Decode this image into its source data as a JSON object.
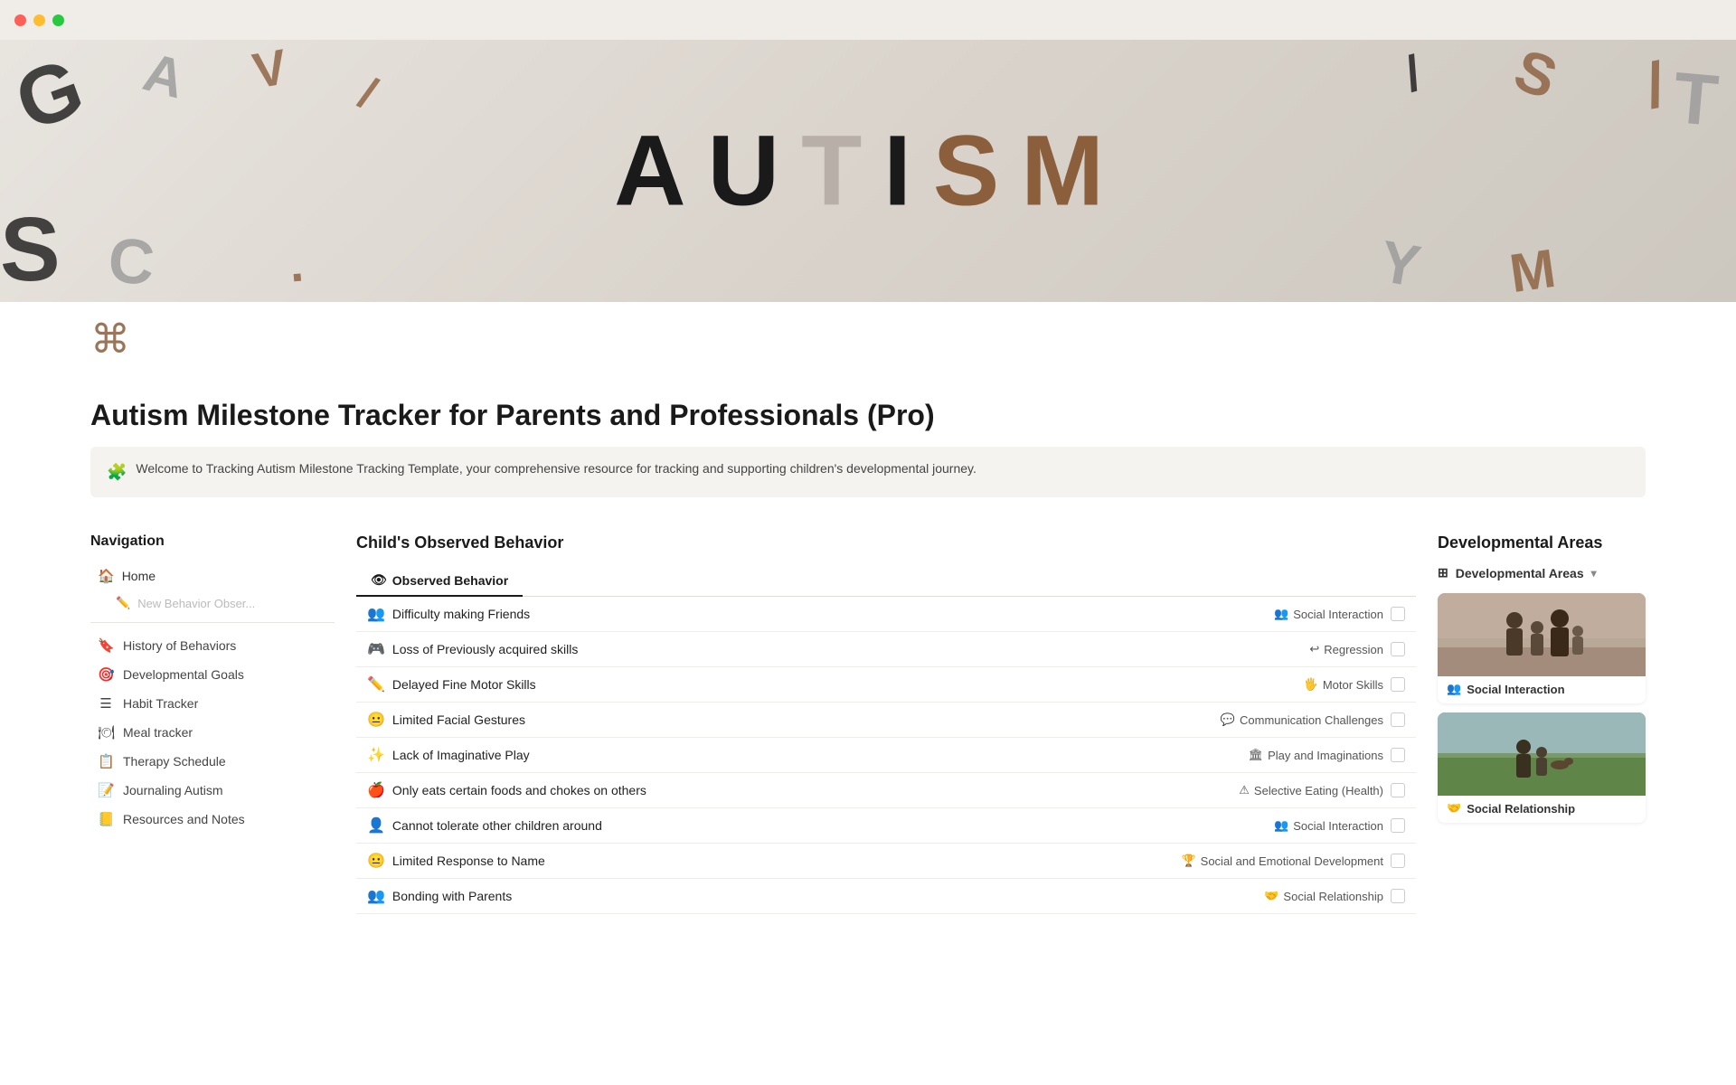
{
  "titlebar": {
    "dots": [
      "red",
      "yellow",
      "green"
    ]
  },
  "hero": {
    "word_letters": [
      {
        "char": "A",
        "style": "black"
      },
      {
        "char": "U",
        "style": "black"
      },
      {
        "char": "T",
        "style": "gray"
      },
      {
        "char": "I",
        "style": "black"
      },
      {
        "char": "S",
        "style": "brown"
      },
      {
        "char": "M",
        "style": "brown"
      }
    ]
  },
  "page": {
    "main_title": "Autism Milestone Tracker for Parents and Professionals (Pro)",
    "welcome_text": "Welcome to Tracking Autism Milestone Tracking Template, your comprehensive resource for tracking and supporting children's developmental journey."
  },
  "sidebar": {
    "title": "Navigation",
    "home_label": "Home",
    "new_behavior_placeholder": "New Behavior Obser...",
    "items": [
      {
        "icon": "🔖",
        "label": "History of Behaviors"
      },
      {
        "icon": "🎯",
        "label": "Developmental Goals"
      },
      {
        "icon": "☰",
        "label": "Habit Tracker"
      },
      {
        "icon": "🍽",
        "label": "Meal tracker"
      },
      {
        "icon": "📋",
        "label": "Therapy Schedule"
      },
      {
        "icon": "📝",
        "label": "Journaling Autism"
      },
      {
        "icon": "📒",
        "label": "Resources and Notes"
      }
    ]
  },
  "center": {
    "title": "Child's Observed Behavior",
    "tab_label": "Observed Behavior",
    "behaviors": [
      {
        "icon": "👥",
        "name": "Difficulty making Friends",
        "tag_icon": "👥",
        "tag_label": "Social Interaction"
      },
      {
        "icon": "🎮",
        "name": "Loss of Previously acquired skills",
        "tag_icon": "↩",
        "tag_label": "Regression"
      },
      {
        "icon": "✏️",
        "name": "Delayed Fine Motor Skills",
        "tag_icon": "🖐",
        "tag_label": "Motor Skills"
      },
      {
        "icon": "😐",
        "name": "Limited Facial Gestures",
        "tag_icon": "💬",
        "tag_label": "Communication Challenges"
      },
      {
        "icon": "✨",
        "name": "Lack of Imaginative Play",
        "tag_icon": "🏛",
        "tag_label": "Play and Imaginations"
      },
      {
        "icon": "🍎",
        "name": "Only eats certain foods and chokes on others",
        "tag_icon": "⚠",
        "tag_label": "Selective Eating (Health)"
      },
      {
        "icon": "👤",
        "name": "Cannot tolerate other children around",
        "tag_icon": "👥",
        "tag_label": "Social Interaction"
      },
      {
        "icon": "😐",
        "name": "Limited Response to Name",
        "tag_icon": "🏆",
        "tag_label": "Social and Emotional Development"
      },
      {
        "icon": "👥",
        "name": "Bonding with Parents",
        "tag_icon": "🤝",
        "tag_label": "Social Relationship"
      }
    ]
  },
  "right_sidebar": {
    "title": "Developmental Areas",
    "dropdown_label": "Developmental Areas",
    "cards": [
      {
        "label": "Social Interaction",
        "icon": "👥",
        "photo_type": "family"
      },
      {
        "label": "Social Relationship",
        "icon": "🤝",
        "photo_type": "field"
      }
    ]
  }
}
